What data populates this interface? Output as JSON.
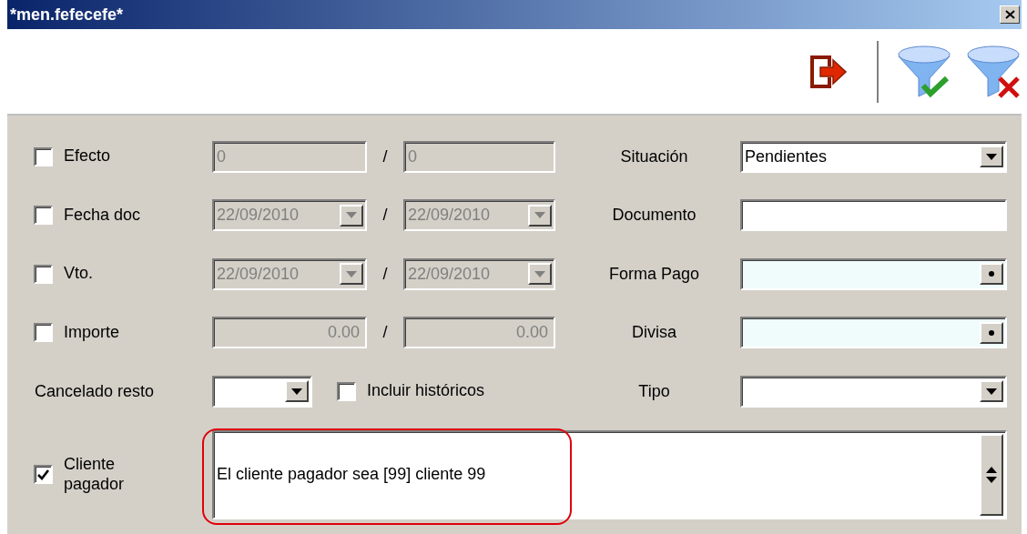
{
  "window": {
    "title": "*men.fefecefe*"
  },
  "filters": [
    {
      "label": "Efecto",
      "checked": false,
      "kind": "text",
      "from": "0",
      "separator": "/",
      "to": "0",
      "disabled": true
    },
    {
      "label": "Fecha doc",
      "checked": false,
      "kind": "date",
      "from": "22/09/2010",
      "separator": "/",
      "to": "22/09/2010",
      "disabled": true
    },
    {
      "label": "Vto.",
      "checked": false,
      "kind": "date",
      "from": "22/09/2010",
      "separator": "/",
      "to": "22/09/2010",
      "disabled": true
    },
    {
      "label": "Importe",
      "checked": false,
      "kind": "number",
      "from": "0.00",
      "separator": "/",
      "to": "0.00",
      "disabled": true
    }
  ],
  "cancelado_resto": {
    "label": "Cancelado resto"
  },
  "incluir_historicos": {
    "label": "Incluir históricos",
    "checked": false
  },
  "right_fields": [
    {
      "label": "Situación",
      "kind": "dropdown",
      "value": "Pendientes"
    },
    {
      "label": "Documento",
      "kind": "text"
    },
    {
      "label": "Forma Pago",
      "kind": "lookup"
    },
    {
      "label": "Divisa",
      "kind": "lookup"
    },
    {
      "label": "Tipo",
      "kind": "dropdown"
    }
  ],
  "cliente_pagador": {
    "label": "Cliente pagador",
    "checked": true,
    "value": "El cliente pagador sea  [99] cliente 99"
  }
}
